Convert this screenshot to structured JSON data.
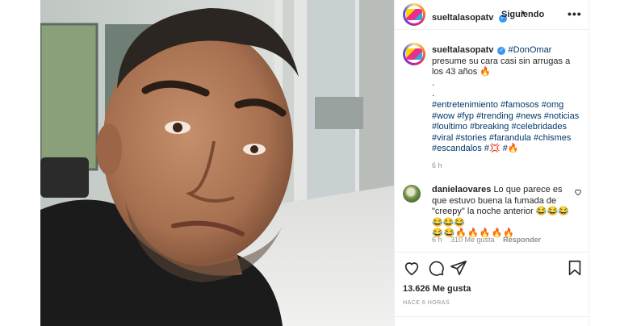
{
  "post": {
    "username": "sueltalasopatv",
    "verified_icon": "verified-badge-icon",
    "separator": "•",
    "follow_status": "Siguiendo",
    "more_icon": "ellipsis-icon",
    "caption": {
      "mention": "#DonOmar",
      "text": " presume su cara casi sin arrugas a los 43 años 🔥",
      "dot1": ".",
      "dot2": ".",
      "hashtags": "#entretenimiento #famosos #omg #wow #fyp #trending #news #noticias #loultimo #breaking #celebridades #viral #stories #farandula #chismes #escandalos #💢 #🔥",
      "time": "6 h"
    },
    "comment": {
      "username": "danielaovares",
      "text": "Lo que parece es que estuvo buena la fumada de \"creepy\" la noche anterior 😂😂😂😂😂😂",
      "emojis": "😂😂🔥🔥🔥🔥🔥",
      "time": "6 h",
      "likes": "310 Me gusta",
      "reply": "Responder"
    },
    "likes_count": "13.626 Me gusta",
    "posted_ago": "HACE 6 HORAS"
  },
  "colors": {
    "link": "#00376b",
    "verified": "#3897f0",
    "muted": "#8e8e8e",
    "text": "#262626"
  }
}
